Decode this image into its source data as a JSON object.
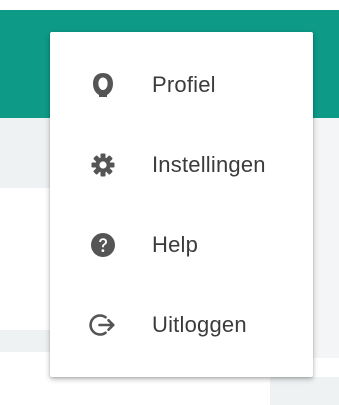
{
  "menu": {
    "items": [
      {
        "label": "Profiel",
        "icon": "profile-icon"
      },
      {
        "label": "Instellingen",
        "icon": "gear-icon"
      },
      {
        "label": "Help",
        "icon": "help-icon"
      },
      {
        "label": "Uitloggen",
        "icon": "logout-icon"
      }
    ]
  },
  "colors": {
    "header": "#0d9b87",
    "icon": "#555555",
    "text": "#3b3b3b"
  }
}
